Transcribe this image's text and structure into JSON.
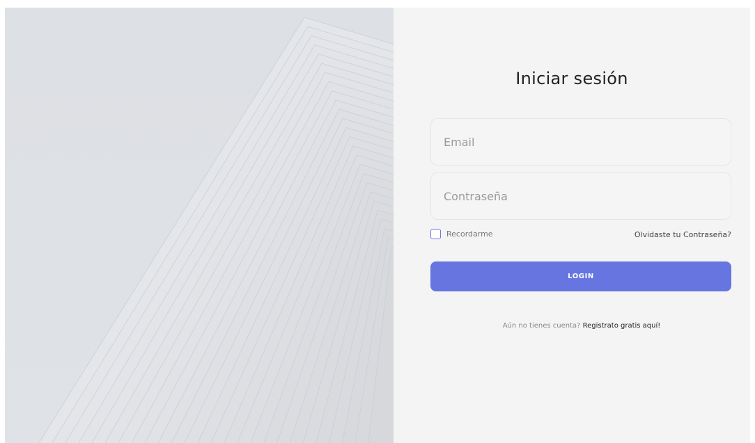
{
  "login": {
    "title": "Iniciar sesión",
    "email_placeholder": "Email",
    "password_placeholder": "Contraseña",
    "remember_label": "Recordarme",
    "remember_checked": false,
    "forgot_link": "Olvidaste tu Contraseña?",
    "login_button": "LOGIN",
    "signup_prompt": "Aún no tienes cuenta?",
    "signup_link": "Registrato gratis aquí!"
  },
  "colors": {
    "accent": "#6675e0",
    "panel_background": "#f4f4f4",
    "hero_background": "#dde0e4"
  }
}
